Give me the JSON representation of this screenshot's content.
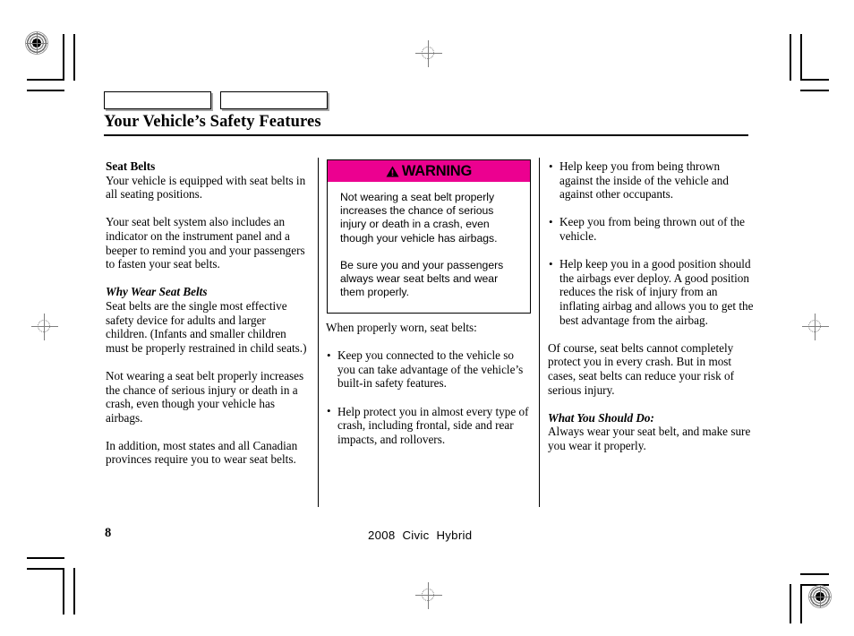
{
  "page": {
    "title": "Your Vehicle’s Safety Features",
    "number": "8",
    "footer_model": "2008  Civic  Hybrid"
  },
  "colors": {
    "warning_banner": "#ec0090",
    "text": "#000000",
    "page_background": "#ffffff"
  },
  "header": {
    "tab_left_label": "",
    "tab_right_label": ""
  },
  "left_column": {
    "heading": "Seat Belts",
    "paragraph_1": "Your vehicle is equipped with seat belts in all seating positions.",
    "paragraph_2": "Your seat belt system also includes an indicator on the instrument panel and a beeper to remind you and your passengers to fasten your seat belts.",
    "subheading": "Why Wear Seat Belts",
    "paragraph_3": "Seat belts are the single most effective safety device for adults and larger children. (Infants and smaller children must be properly restrained in child seats.)",
    "paragraph_4": "Not wearing a seat belt properly increases the chance of serious injury or death in a crash, even though your vehicle has airbags.",
    "paragraph_5": "In addition, most states and all Canadian provinces require you to wear seat belts."
  },
  "warning_box": {
    "icon": "warning-triangle-icon",
    "banner_label": "WARNING",
    "paragraph_1": "Not wearing a seat belt properly increases the chance of serious injury or death in a crash, even though your vehicle has airbags.",
    "paragraph_2": "Be sure you and your passengers always wear seat belts and wear them properly."
  },
  "middle_column": {
    "lead_in": "When properly worn, seat belts:",
    "bullets": [
      "Keep you connected to the vehicle so you can take advantage of the vehicle’s built-in safety features.",
      "Help protect you in almost every type of crash, including frontal, side and rear impacts, and rollovers."
    ]
  },
  "right_column": {
    "bullets": [
      "Help keep you from being thrown against the inside of the vehicle and against other occupants.",
      "Keep you from being thrown out of the vehicle.",
      "Help keep you in a good position should the airbags ever deploy. A good position reduces the risk of injury from an inflating airbag and allows you to get the best advantage from the airbag."
    ],
    "paragraph_1": "Of course, seat belts cannot completely protect you in every crash. But in most cases, seat belts can reduce your risk of serious injury.",
    "subheading": "What You Should Do:",
    "paragraph_2": "Always wear your seat belt, and make sure you wear it properly."
  }
}
